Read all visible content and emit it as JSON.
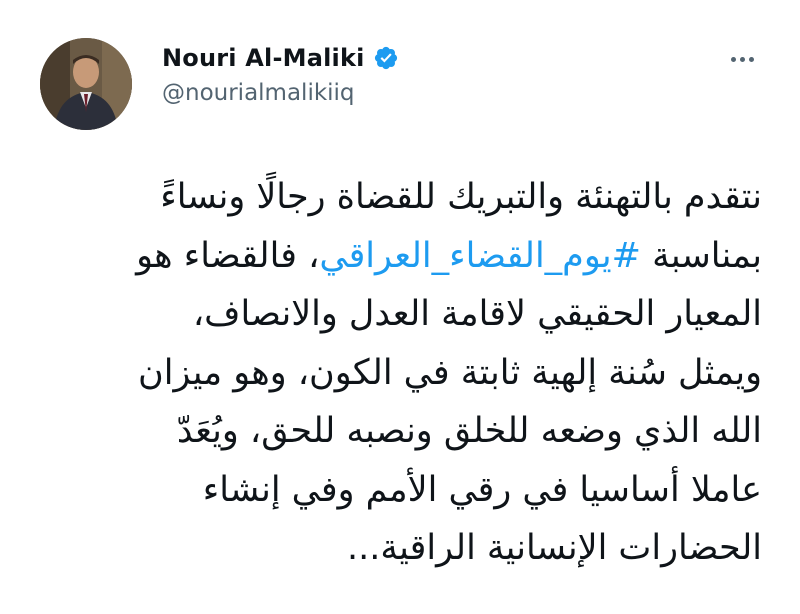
{
  "tweet": {
    "author": {
      "display_name": "Nouri Al-Maliki",
      "handle": "@nourialmalikiiq",
      "verified_icon": "verified-badge-icon",
      "avatar_icon": "profile-photo"
    },
    "more_icon": "more-options-icon",
    "colors": {
      "text": "#0f1419",
      "secondary": "#536471",
      "link": "#1d9bf0",
      "verified": "#1d9bf0",
      "background": "#ffffff"
    },
    "body": {
      "line1": "نتقدم بالتهنئة والتبريك للقضاة رجالًا ونساءً",
      "line2_pre": "بمناسبة ",
      "line2_hashtag": "#يوم_القضاء_العراقي",
      "line2_post": "، فالقضاء هو",
      "line3": "المعيار الحقيقي لاقامة العدل والانصاف،",
      "line4": "ويمثل سُنة إلهية ثابتة في الكون، وهو ميزان",
      "line5": "الله الذي وضعه للخلق ونصبه للحق، ويُعَدّ",
      "line6": "عاملا أساسيا في رقي الأمم وفي إنشاء",
      "line7": "الحضارات الإنسانية الراقية..."
    }
  }
}
